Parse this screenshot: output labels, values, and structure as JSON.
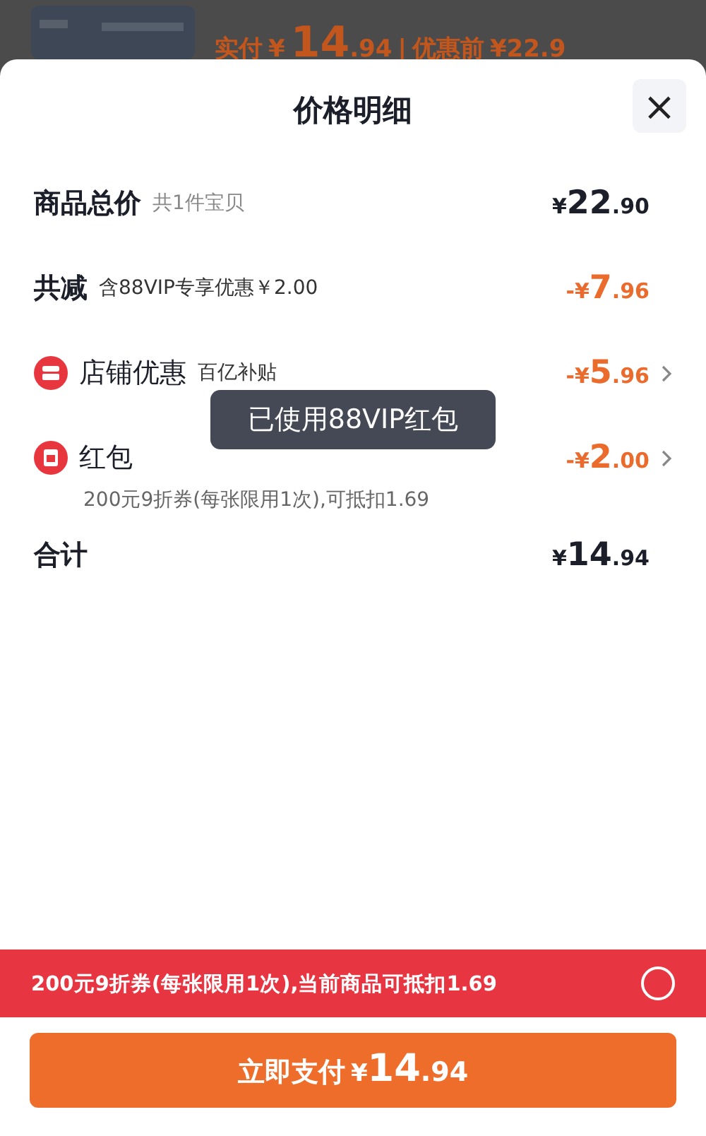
{
  "background": {
    "price_label": "实付",
    "price_yen": "¥",
    "price_int": "14",
    "price_dec": ".94",
    "separator": "|",
    "original_label": "优惠前",
    "original_price": "¥22.9"
  },
  "sheet": {
    "title": "价格明细",
    "close": "×"
  },
  "rows": [
    {
      "kind": "total",
      "label": "商品总价",
      "note": "共1件宝贝",
      "sign": "¥",
      "int": "22",
      "dec": ".90"
    },
    {
      "kind": "discount",
      "label": "共减",
      "note": "含88VIP专享优惠￥2.00",
      "sign": "-¥",
      "int": "7",
      "dec": ".96"
    },
    {
      "kind": "store",
      "label": "店铺优惠",
      "note": "百亿补贴",
      "sign": "-¥",
      "int": "5",
      "dec": ".96"
    },
    {
      "kind": "packet",
      "label": "红包",
      "detail": "200元9折券(每张限用1次),可抵扣1.69",
      "sign": "-¥",
      "int": "2",
      "dec": ".00"
    },
    {
      "kind": "total",
      "label": "合计",
      "sign": "¥",
      "int": "14",
      "dec": ".94"
    }
  ],
  "toast": "已使用88VIP红包",
  "coupon": {
    "text": "200元9折券(每张限用1次),当前商品可抵扣1.69",
    "selected": false
  },
  "pay_button": {
    "label": "立即支付",
    "yen": "¥",
    "int": "14",
    "dec": ".94"
  }
}
